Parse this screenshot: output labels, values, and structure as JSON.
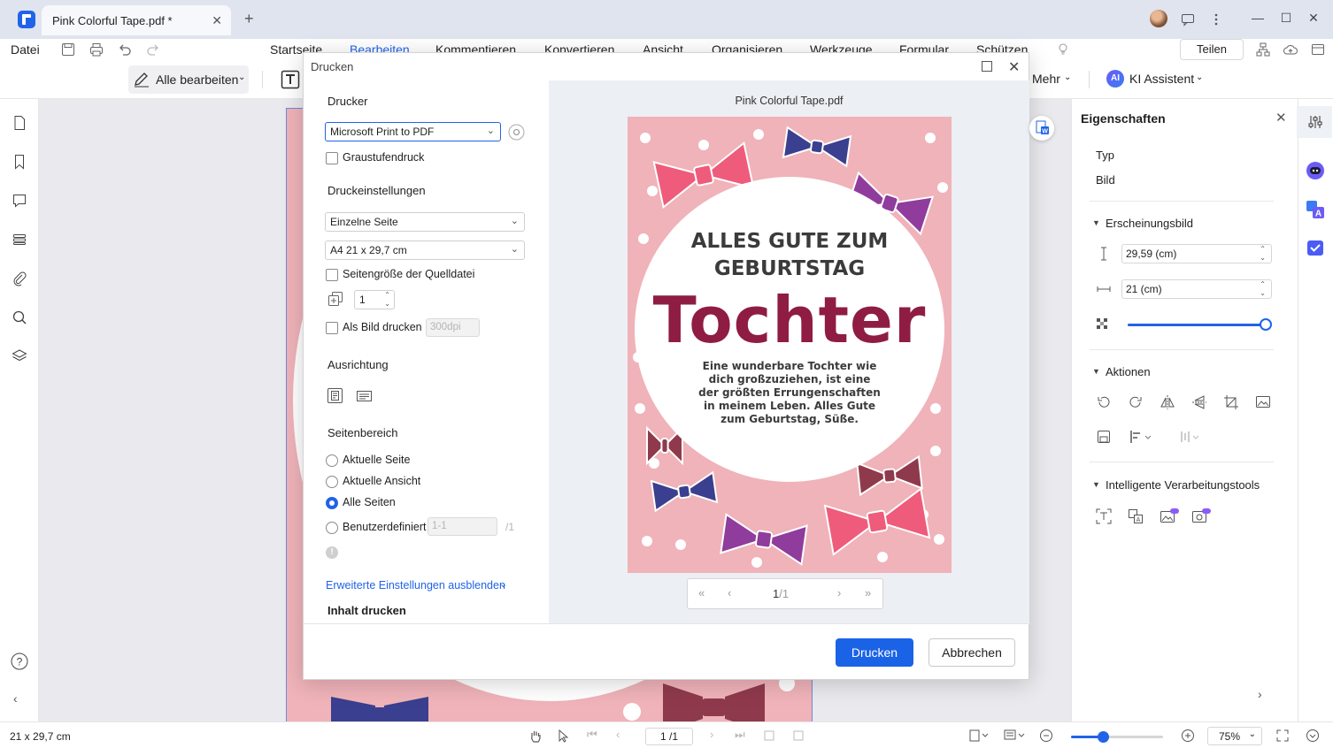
{
  "titlebar": {
    "tab_title": "Pink Colorful Tape.pdf *",
    "tab_close": "✕",
    "new_tab": "+",
    "window_controls": [
      "—",
      "☐",
      "✕"
    ]
  },
  "menu": {
    "file": "Datei",
    "items": [
      "Startseite",
      "Bearbeiten",
      "Kommentieren",
      "Konvertieren",
      "Ansicht",
      "Organisieren",
      "Werkzeuge",
      "Formular",
      "Schützen"
    ],
    "active_item": "Bearbeiten",
    "share": "Teilen"
  },
  "toolbar": {
    "edit_all": "Alle bearbeiten",
    "more": "Mehr",
    "ai_badge": "AI",
    "ai_label": "KI Assistent"
  },
  "left_rail_icons": [
    "page-thumbnails-icon",
    "bookmark-icon",
    "comment-icon",
    "fields-icon",
    "attachment-icon",
    "search-icon",
    "layers-icon"
  ],
  "properties": {
    "title": "Eigenschaften",
    "type_label": "Typ",
    "type_value": "Bild",
    "appearance_heading": "Erscheinungsbild",
    "height_value": "29,59 (cm)",
    "width_value": "21 (cm)",
    "opacity_fraction": 1.0,
    "actions_heading": "Aktionen",
    "smart_tools_heading": "Intelligente Verarbeitungstools"
  },
  "statusbar": {
    "page_size": "21 x 29,7 cm",
    "page_indicator": "1 /1",
    "zoom": "75%",
    "zoom_fraction": 0.35
  },
  "dialog": {
    "title": "Drucken",
    "printer_heading": "Drucker",
    "printer_value": "Microsoft Print to PDF",
    "grayscale_label": "Graustufendruck",
    "settings_heading": "Druckeinstellungen",
    "page_mode": "Einzelne Seite",
    "paper_size": "A4 21 x 29,7 cm",
    "source_size_label": "Seitengröße der Quelldatei",
    "copies": "1",
    "as_image_label": "Als Bild drucken",
    "dpi_placeholder": "300dpi",
    "orientation_heading": "Ausrichtung",
    "range_heading": "Seitenbereich",
    "range_options": [
      "Aktuelle Seite",
      "Aktuelle Ansicht",
      "Alle Seiten",
      "Benutzerdefiniert"
    ],
    "range_selected": "Alle Seiten",
    "custom_range_placeholder": "1-1",
    "custom_range_total": "/1",
    "advanced_link": "Erweiterte Einstellungen ausblenden",
    "content_heading_partial": "Inhalt drucken",
    "preview_title": "Pink Colorful Tape.pdf",
    "pager_current": "1",
    "pager_total": "/1",
    "print_button": "Drucken",
    "cancel_button": "Abbrechen"
  },
  "document": {
    "headline_line1": "ALLES GUTE ZUM",
    "headline_line2": "GEBURTSTAG",
    "name": "Tochter",
    "body": "Eine wunderbare Tochter wie dich großzuziehen, ist eine der größten Errungenschaften in meinem Leben. Alles Gute zum Geburtstag, Süße.",
    "colors": {
      "background": "#efb3b9",
      "accent": "#8f1c43",
      "bow_pink": "#ef5b7b",
      "bow_purple": "#8f3c9c",
      "bow_navy": "#3a3f8f",
      "bow_maroon": "#8f3a4c"
    }
  }
}
